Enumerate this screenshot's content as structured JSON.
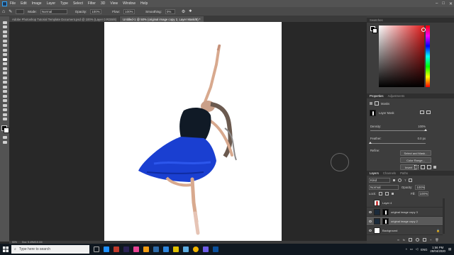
{
  "menu": [
    "File",
    "Edit",
    "Image",
    "Layer",
    "Type",
    "Select",
    "Filter",
    "3D",
    "View",
    "Window",
    "Help"
  ],
  "options": {
    "mode_label": "Mode:",
    "mode_value": "Normal",
    "opacity_label": "Opacity:",
    "opacity_value": "100%",
    "flow_label": "Flow:",
    "flow_value": "100%",
    "smoothing_label": "Smoothing:",
    "smoothing_value": "0%"
  },
  "tabs": [
    {
      "label": "Adobe Photoshop Tutorial Template Document.psd @ 100% (Layer 0 RGB/8)",
      "active": false
    },
    {
      "label": "Untitled-1 @ 50% (original image copy 2, Layer Mask/8) *",
      "active": true
    }
  ],
  "status": {
    "zoom": "50%",
    "doc": "Doc: 5.49M/15.1M"
  },
  "color_panel": {
    "tab_swatches": "Swatches",
    "tab_color": "Color"
  },
  "properties": {
    "tab1": "Properties",
    "tab2": "Adjustments",
    "section": "Masks",
    "mask_label": "Layer Mask",
    "density_label": "Density:",
    "density_value": "100%",
    "feather_label": "Feather:",
    "feather_value": "0.0 px",
    "refine_label": "Refine:",
    "select_mask_btn": "Select and Mask...",
    "color_range_btn": "Color Range...",
    "invert_btn": "Invert"
  },
  "layers_panel": {
    "tab1": "Layers",
    "tab2": "Channels",
    "tab3": "Paths",
    "kind_label": "Kind",
    "blend": "Normal",
    "opacity_label": "Opacity:",
    "opacity_value": "100%",
    "lock_label": "Lock:",
    "fill_label": "Fill:",
    "fill_value": "100%",
    "layers": [
      {
        "name": "Layer 4",
        "visible": false,
        "selected": false,
        "has_mask": false
      },
      {
        "name": "original image copy 3",
        "visible": true,
        "selected": false,
        "has_mask": true
      },
      {
        "name": "original image copy 2",
        "visible": true,
        "selected": true,
        "has_mask": true
      },
      {
        "name": "Background",
        "visible": true,
        "selected": false,
        "has_mask": false
      }
    ]
  },
  "taskbar": {
    "search_placeholder": "Type here to search",
    "time": "1:56 PM",
    "date": "28/04/2020",
    "lang": "ENG"
  },
  "colors": {
    "accent": "#31a8ff",
    "dress": "#1a3fd1",
    "canvas": "#ffffff"
  }
}
